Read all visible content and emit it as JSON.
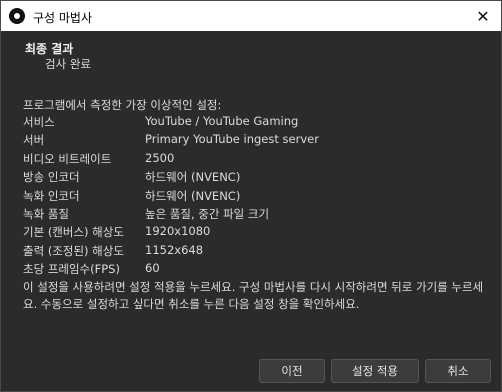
{
  "window": {
    "title": "구성 마법사",
    "close_glyph": "✕"
  },
  "header": {
    "title": "최종 결과",
    "subtitle": "검사 완료"
  },
  "results": {
    "intro": "프로그램에서 측정한 가장 이상적인 설정:",
    "rows": [
      {
        "key": "서비스",
        "value": "YouTube / YouTube Gaming"
      },
      {
        "key": "서버",
        "value": "Primary YouTube ingest server"
      },
      {
        "key": "비디오 비트레이트",
        "value": "2500"
      },
      {
        "key": "방송 인코더",
        "value": "하드웨어 (NVENC)"
      },
      {
        "key": "녹화 인코더",
        "value": "하드웨어 (NVENC)"
      },
      {
        "key": "녹화 품질",
        "value": "높은 품질, 중간 파일 크기"
      },
      {
        "key": "기본 (캔버스) 해상도",
        "value": "1920x1080"
      },
      {
        "key": "출력 (조정된) 해상도",
        "value": "1152x648"
      },
      {
        "key": "초당 프레임수(FPS)",
        "value": "60"
      }
    ],
    "note": "이 설정을 사용하려면 설정 적용을 누르세요. 구성 마법사를 다시 시작하려면 뒤로 가기를 누르세요. 수동으로 설정하고 싶다면 취소를 누른 다음 설정 창을 확인하세요."
  },
  "footer": {
    "prev_label": "이전",
    "apply_label": "설정 적용",
    "cancel_label": "취소"
  }
}
